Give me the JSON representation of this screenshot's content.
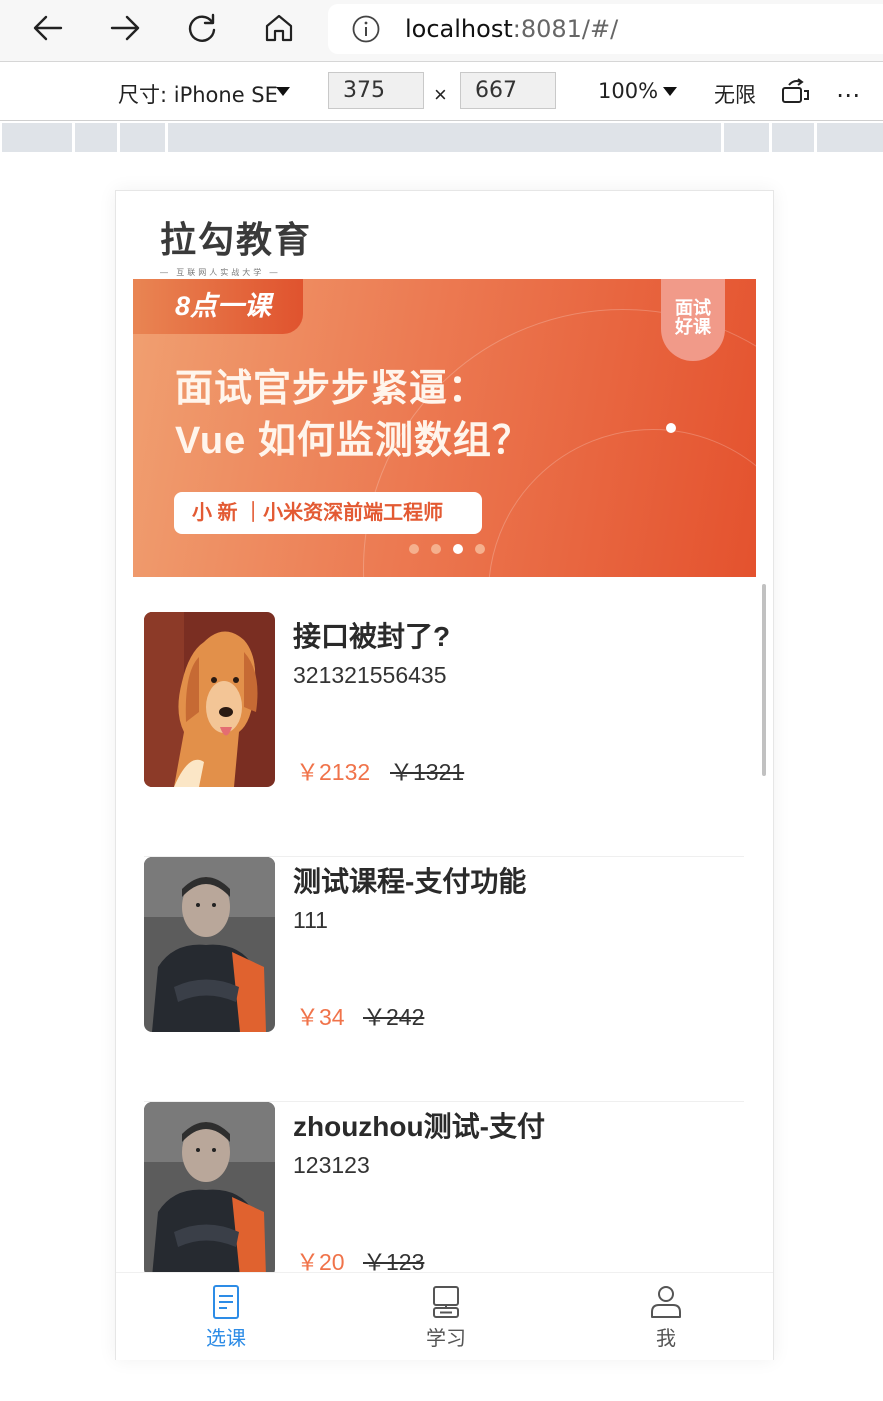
{
  "browser": {
    "url_host": "localhost",
    "url_rest": ":8081/#/"
  },
  "device_toolbar": {
    "size_label": "尺寸: iPhone SE",
    "width": "375",
    "height": "667",
    "times": "×",
    "zoom": "100%",
    "throttle": "无限",
    "more": "⋯"
  },
  "app": {
    "logo_text": "拉勾教育",
    "logo_sub": "— 互联网人实战大学 —",
    "banner": {
      "tag": "8点一课",
      "badge_line1": "面试",
      "badge_line2": "好课",
      "title_line1": "面试官步步紧逼：",
      "title_line2": "Vue 如何监测数组？",
      "pill": "小 新 ｜小米资深前端工程师",
      "dot_count": 4,
      "active_dot": 3
    },
    "courses": [
      {
        "title": "接口被封了?",
        "desc": "321321556435",
        "price": "￥2132",
        "old_price": "￥1321",
        "thumb": "dog-photo"
      },
      {
        "title": "测试课程-支付功能",
        "desc": "111",
        "price": "￥34",
        "old_price": "￥242",
        "thumb": "person-photo"
      },
      {
        "title": "zhouzhou测试-支付",
        "desc": "123123",
        "price": "￥20",
        "old_price": "￥123",
        "thumb": "person-photo"
      }
    ],
    "tabs": [
      {
        "label": "选课",
        "icon": "document-icon",
        "active": true
      },
      {
        "label": "学习",
        "icon": "monitor-icon",
        "active": false
      },
      {
        "label": "我",
        "icon": "user-icon",
        "active": false
      }
    ],
    "colors": {
      "price": "#f0734a",
      "active_tab": "#2d8ce6",
      "banner": "#e4522e"
    }
  }
}
